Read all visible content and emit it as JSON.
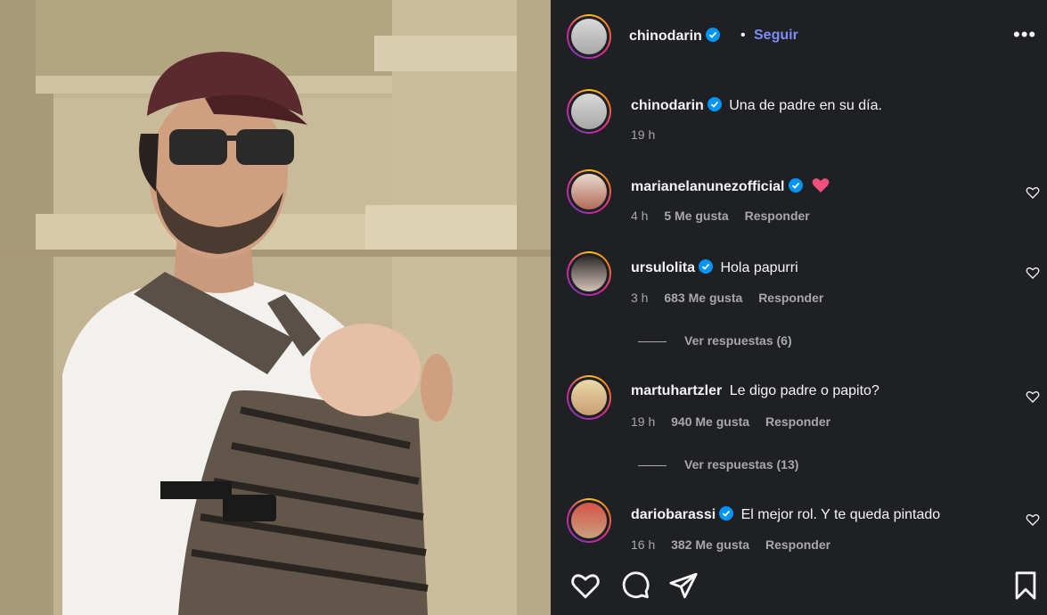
{
  "post": {
    "author": "chinodarin",
    "follow_label": "Seguir",
    "dot": "•",
    "more": "•••"
  },
  "caption": {
    "user": "chinodarin",
    "text": "Una de padre en su día.",
    "time": "19 h"
  },
  "comments": [
    {
      "user": "marianelanunezofficial",
      "text": "",
      "emoji": "heart-emoji",
      "time": "4 h",
      "likes": "5 Me gusta",
      "reply": "Responder"
    },
    {
      "user": "ursulolita",
      "text": "Hola papurri",
      "time": "3 h",
      "likes": "683 Me gusta",
      "reply": "Responder",
      "view_replies": "Ver respuestas (6)"
    },
    {
      "user": "martuhartzler",
      "text": "Le digo padre o papito?",
      "time": "19 h",
      "likes": "940 Me gusta",
      "reply": "Responder",
      "view_replies": "Ver respuestas (13)"
    },
    {
      "user": "dariobarassi",
      "text": "El mejor rol. Y te queda pintado",
      "time": "16 h",
      "likes": "382 Me gusta",
      "reply": "Responder"
    }
  ],
  "icons": [
    "heart-icon",
    "comment-icon",
    "share-icon",
    "bookmark-icon",
    "verified-icon"
  ],
  "colors": {
    "panel_bg": "#1f2024",
    "link": "#7c8cf8",
    "verified": "#0095f6",
    "muted": "#a8a8a8"
  }
}
